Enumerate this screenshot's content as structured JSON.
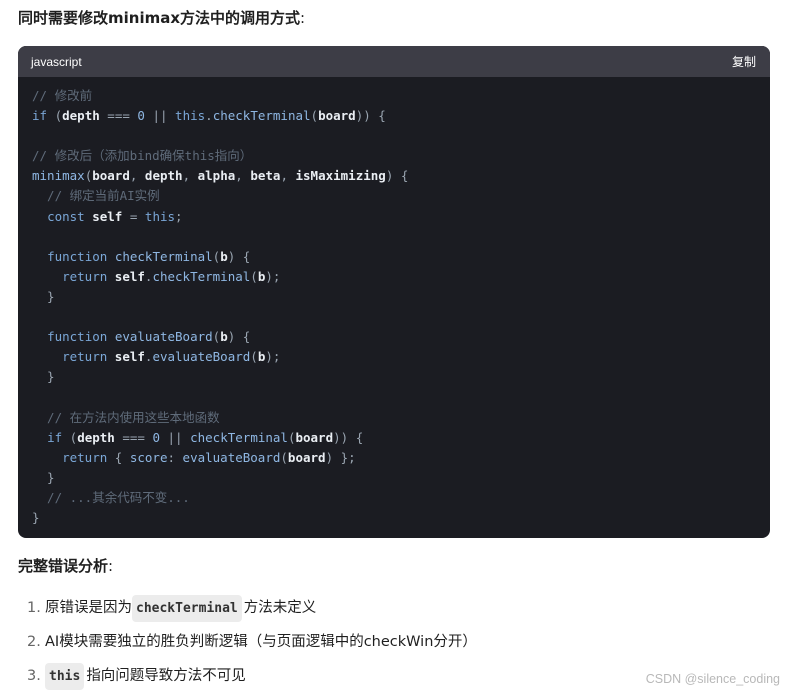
{
  "heading": {
    "text": "同时需要修改minimax方法中的调用方式",
    "colon": ":"
  },
  "code_block": {
    "language": "javascript",
    "copy_label": "复制",
    "lines": [
      [
        {
          "t": "// 修改前",
          "c": "com"
        }
      ],
      [
        {
          "t": "if",
          "c": "kw"
        },
        {
          "t": " (",
          "c": "op"
        },
        {
          "t": "depth",
          "c": "var"
        },
        {
          "t": " === ",
          "c": "op"
        },
        {
          "t": "0",
          "c": "num"
        },
        {
          "t": " || ",
          "c": "op"
        },
        {
          "t": "this",
          "c": "kw"
        },
        {
          "t": ".",
          "c": "op"
        },
        {
          "t": "checkTerminal",
          "c": "fn"
        },
        {
          "t": "(",
          "c": "op"
        },
        {
          "t": "board",
          "c": "var"
        },
        {
          "t": ")) {",
          "c": "op"
        }
      ],
      [],
      [
        {
          "t": "// 修改后（添加bind确保this指向）",
          "c": "com"
        }
      ],
      [
        {
          "t": "minimax",
          "c": "fn"
        },
        {
          "t": "(",
          "c": "op"
        },
        {
          "t": "board",
          "c": "var"
        },
        {
          "t": ", ",
          "c": "op"
        },
        {
          "t": "depth",
          "c": "var"
        },
        {
          "t": ", ",
          "c": "op"
        },
        {
          "t": "alpha",
          "c": "var"
        },
        {
          "t": ", ",
          "c": "op"
        },
        {
          "t": "beta",
          "c": "var"
        },
        {
          "t": ", ",
          "c": "op"
        },
        {
          "t": "isMaximizing",
          "c": "var"
        },
        {
          "t": ") {",
          "c": "op"
        }
      ],
      [
        {
          "t": "  // 绑定当前AI实例",
          "c": "com"
        }
      ],
      [
        {
          "t": "  ",
          "c": "op"
        },
        {
          "t": "const",
          "c": "kw"
        },
        {
          "t": " ",
          "c": "op"
        },
        {
          "t": "self",
          "c": "var"
        },
        {
          "t": " = ",
          "c": "op"
        },
        {
          "t": "this",
          "c": "kw"
        },
        {
          "t": ";",
          "c": "op"
        }
      ],
      [],
      [
        {
          "t": "  ",
          "c": "op"
        },
        {
          "t": "function",
          "c": "kw"
        },
        {
          "t": " ",
          "c": "op"
        },
        {
          "t": "checkTerminal",
          "c": "fn"
        },
        {
          "t": "(",
          "c": "op"
        },
        {
          "t": "b",
          "c": "var"
        },
        {
          "t": ") {",
          "c": "op"
        }
      ],
      [
        {
          "t": "    ",
          "c": "op"
        },
        {
          "t": "return",
          "c": "kw"
        },
        {
          "t": " ",
          "c": "op"
        },
        {
          "t": "self",
          "c": "var"
        },
        {
          "t": ".",
          "c": "op"
        },
        {
          "t": "checkTerminal",
          "c": "fn"
        },
        {
          "t": "(",
          "c": "op"
        },
        {
          "t": "b",
          "c": "var"
        },
        {
          "t": ");",
          "c": "op"
        }
      ],
      [
        {
          "t": "  }",
          "c": "op"
        }
      ],
      [],
      [
        {
          "t": "  ",
          "c": "op"
        },
        {
          "t": "function",
          "c": "kw"
        },
        {
          "t": " ",
          "c": "op"
        },
        {
          "t": "evaluateBoard",
          "c": "fn"
        },
        {
          "t": "(",
          "c": "op"
        },
        {
          "t": "b",
          "c": "var"
        },
        {
          "t": ") {",
          "c": "op"
        }
      ],
      [
        {
          "t": "    ",
          "c": "op"
        },
        {
          "t": "return",
          "c": "kw"
        },
        {
          "t": " ",
          "c": "op"
        },
        {
          "t": "self",
          "c": "var"
        },
        {
          "t": ".",
          "c": "op"
        },
        {
          "t": "evaluateBoard",
          "c": "fn"
        },
        {
          "t": "(",
          "c": "op"
        },
        {
          "t": "b",
          "c": "var"
        },
        {
          "t": ");",
          "c": "op"
        }
      ],
      [
        {
          "t": "  }",
          "c": "op"
        }
      ],
      [],
      [
        {
          "t": "  // 在方法内使用这些本地函数",
          "c": "com"
        }
      ],
      [
        {
          "t": "  ",
          "c": "op"
        },
        {
          "t": "if",
          "c": "kw"
        },
        {
          "t": " (",
          "c": "op"
        },
        {
          "t": "depth",
          "c": "var"
        },
        {
          "t": " === ",
          "c": "op"
        },
        {
          "t": "0",
          "c": "num"
        },
        {
          "t": " || ",
          "c": "op"
        },
        {
          "t": "checkTerminal",
          "c": "fn"
        },
        {
          "t": "(",
          "c": "op"
        },
        {
          "t": "board",
          "c": "var"
        },
        {
          "t": ")) {",
          "c": "op"
        }
      ],
      [
        {
          "t": "    ",
          "c": "op"
        },
        {
          "t": "return",
          "c": "kw"
        },
        {
          "t": " { ",
          "c": "op"
        },
        {
          "t": "score",
          "c": "fn"
        },
        {
          "t": ": ",
          "c": "op"
        },
        {
          "t": "evaluateBoard",
          "c": "fn"
        },
        {
          "t": "(",
          "c": "op"
        },
        {
          "t": "board",
          "c": "var"
        },
        {
          "t": ") };",
          "c": "op"
        }
      ],
      [
        {
          "t": "  }",
          "c": "op"
        }
      ],
      [
        {
          "t": "  // ...其余代码不变...",
          "c": "com"
        }
      ],
      [
        {
          "t": "}",
          "c": "op"
        }
      ]
    ]
  },
  "analysis": {
    "title": "完整错误分析",
    "colon": ":",
    "items": [
      {
        "num": "1.",
        "before": "原错误是因为",
        "code": "checkTerminal",
        "after": "方法未定义"
      },
      {
        "num": "2.",
        "before": "AI模块需要独立的胜负判断逻辑（与页面逻辑中的checkWin分开）",
        "code": "",
        "after": ""
      },
      {
        "num": "3.",
        "before": "",
        "code": "this",
        "after": "指向问题导致方法不可见"
      }
    ]
  },
  "watermark": "CSDN @silence_coding",
  "colors": {
    "code_bg": "#1b1c22",
    "code_header_bg": "#3d3d46",
    "keyword": "#7aa6d6",
    "comment": "#5f6b7a"
  }
}
